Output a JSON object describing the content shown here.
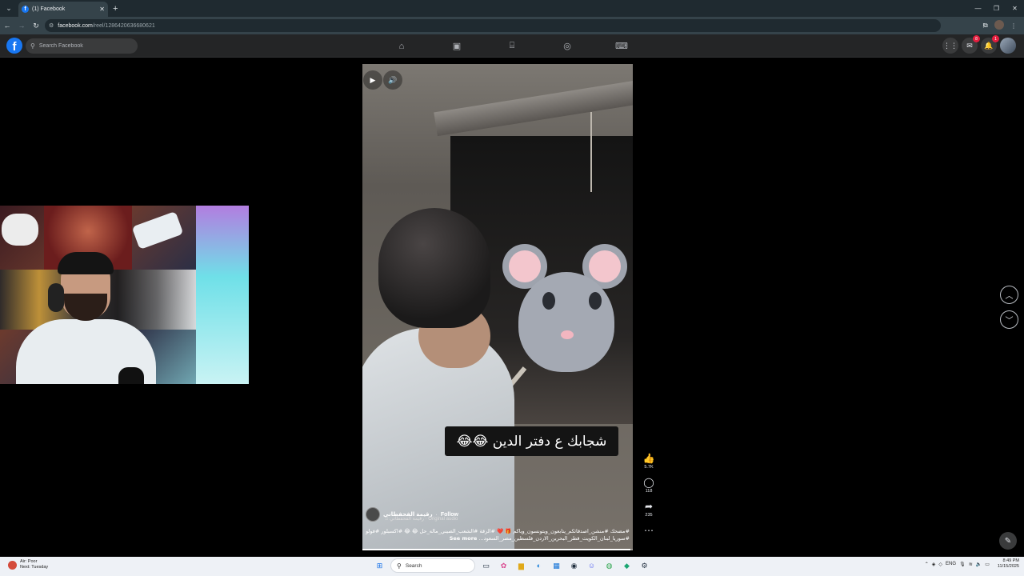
{
  "browser": {
    "tab_title": "(1) Facebook",
    "url_host": "facebook.com",
    "url_path": "/reel/1286420636680621"
  },
  "facebook": {
    "search_placeholder": "Search Facebook",
    "messenger_badge": "8",
    "notifications_badge": "1"
  },
  "reel": {
    "caption": "شجابك ع دفتر الدين 😂😂",
    "username": "رقيمة الفحفطاني",
    "follow_label": "Follow",
    "audio": "رقيمة الفحفطاني · Original audio",
    "description": "#مضحك #منشن_اصدقائكم_يتابعون_ويتونسون_وياكم 🎁 ❤️ #الرقة #الشعب_الصيني_ماله_حل 😂 😂 #اكسبلور #فولو #سوريا_لبنان_الكويت_قطر_البحرين_الاردن_فلسطين_مصر_السعود...",
    "see_more": "See more",
    "likes": "5.7K",
    "comments": "118",
    "shares": "235",
    "progress": 0.99
  },
  "taskbar": {
    "weather_title": "Air: Poor",
    "weather_sub": "Next: Tuesday",
    "search_label": "Search",
    "lang": "ENG",
    "time": "8:49 PM",
    "date": "11/15/2025"
  }
}
